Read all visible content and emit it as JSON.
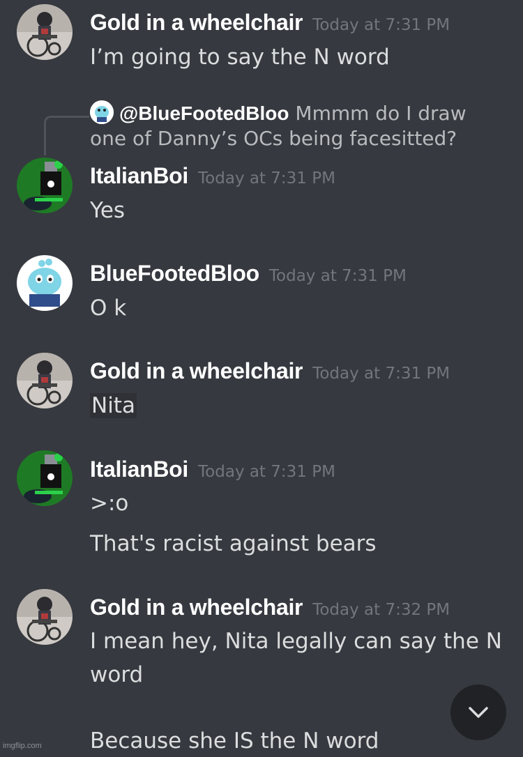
{
  "colors": {
    "background": "#36393f",
    "username": "#ffffff",
    "timestamp": "#72767d",
    "message_text": "#dcddde",
    "reply_line": "#4f545c",
    "scroll_button": "#202225"
  },
  "messages": [
    {
      "username": "Gold in a wheelchair",
      "timestamp": "Today at 7:31 PM",
      "avatar_icon": "wheelchair-avatar-icon",
      "lines": [
        "I’m going to say the N word"
      ]
    },
    {
      "reply": {
        "user": "@BlueFootedBloo",
        "text_line1": "Mmmm do I draw",
        "text_line2": "one of Danny’s OCs being facesitted?"
      },
      "username": "ItalianBoi",
      "timestamp": "Today at 7:31 PM",
      "avatar_icon": "green-character-avatar-icon",
      "lines": [
        "Yes"
      ]
    },
    {
      "username": "BlueFootedBloo",
      "timestamp": "Today at 7:31 PM",
      "avatar_icon": "blue-bird-avatar-icon",
      "lines": [
        "O k"
      ]
    },
    {
      "username": "Gold in a wheelchair",
      "timestamp": "Today at 7:31 PM",
      "avatar_icon": "wheelchair-avatar-icon",
      "lines": [
        "Nita"
      ]
    },
    {
      "username": "ItalianBoi",
      "timestamp": "Today at 7:31 PM",
      "avatar_icon": "green-character-avatar-icon",
      "lines": [
        ">:o",
        "That's racist against bears"
      ]
    },
    {
      "username": "Gold in a wheelchair",
      "timestamp": "Today at 7:32 PM",
      "avatar_icon": "wheelchair-avatar-icon",
      "lines": [
        "I mean hey, Nita legally can say the N",
        "word",
        "Because she IS the N word"
      ]
    }
  ],
  "scroll_button_icon": "chevron-down-icon",
  "watermark": "imgflip.com"
}
